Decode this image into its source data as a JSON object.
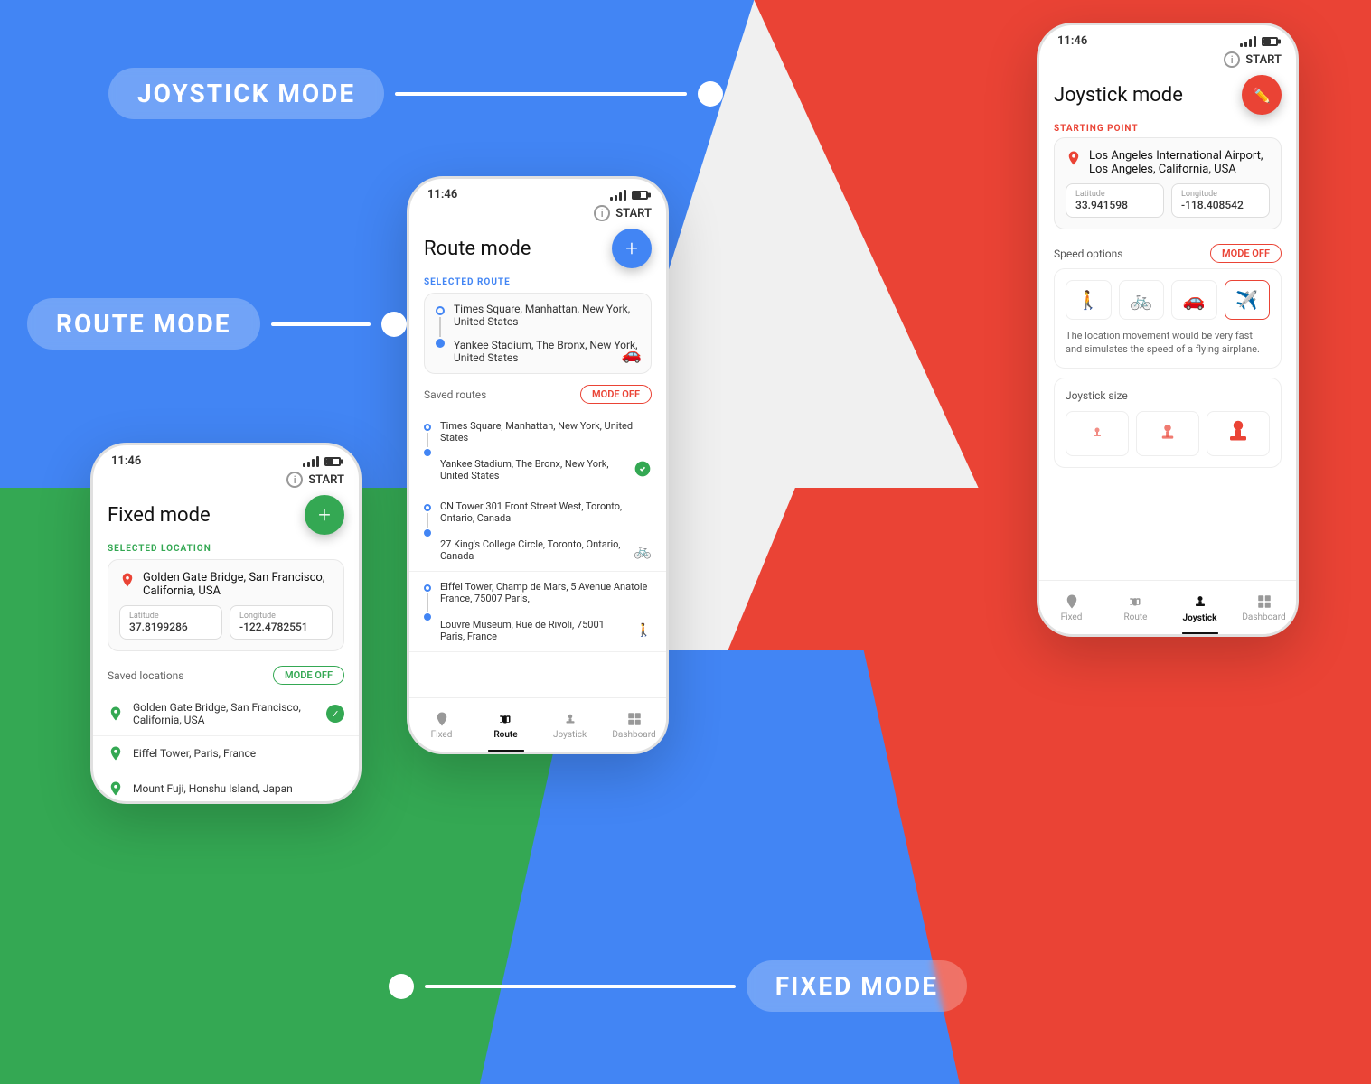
{
  "background": {
    "blue": "#4285F4",
    "green": "#34A853",
    "red": "#EA4335"
  },
  "labels": {
    "joystick": "JOYSTICK MODE",
    "route": "ROUTE MODE",
    "fixed": "FIXED MODE"
  },
  "phone_fixed": {
    "time": "11:46",
    "start": "START",
    "title": "Fixed mode",
    "selected_location_label": "SELECTED LOCATION",
    "location": "Golden Gate Bridge, San Francisco, California, USA",
    "latitude_label": "Latitude",
    "latitude_value": "37.8199286",
    "longitude_label": "Longitude",
    "longitude_value": "-122.4782551",
    "saved_locations": "Saved locations",
    "mode_off": "MODE OFF",
    "saved": [
      {
        "name": "Golden Gate Bridge, San Francisco, California, USA",
        "active": true
      },
      {
        "name": "Eiffel Tower, Paris, France",
        "active": false
      },
      {
        "name": "Mount Fuji, Honshu Island, Japan",
        "active": false
      }
    ],
    "nav": [
      "Fixed",
      "Route",
      "Joystick",
      "Dashboard"
    ]
  },
  "phone_route": {
    "time": "11:46",
    "start": "START",
    "title": "Route mode",
    "selected_route_label": "SELECTED ROUTE",
    "route_from": "Times Square, Manhattan, New York, United States",
    "route_to": "Yankee Stadium, The Bronx, New York, United States",
    "saved_routes": "Saved routes",
    "mode_off": "MODE OFF",
    "routes": [
      {
        "from": "Times Square, Manhattan, New York, United States",
        "to": "Yankee Stadium, The Bronx, New York, United States",
        "icon": "car",
        "active": true
      },
      {
        "from": "CN Tower 301 Front Street West, Toronto, Ontario, Canada",
        "to": "27 King's College Circle, Toronto, Ontario, Canada",
        "icon": "bike",
        "active": false
      },
      {
        "from": "Eiffel Tower, Champ de Mars, 5 Avenue Anatole France, 75007 Paris,",
        "to": "Louvre Museum, Rue de Rivoli, 75001 Paris, France",
        "icon": "person",
        "active": false
      }
    ],
    "nav": [
      "Fixed",
      "Route",
      "Joystick",
      "Dashboard"
    ],
    "active_nav": 1
  },
  "phone_joystick": {
    "time": "11:46",
    "start": "START",
    "title": "Joystick mode",
    "starting_point_label": "STARTING POINT",
    "location": "Los Angeles International Airport, Los Angeles, California, USA",
    "latitude_label": "Latitude",
    "latitude_value": "33.941598",
    "longitude_label": "Longitude",
    "longitude_value": "-118.408542",
    "speed_options_label": "Speed options",
    "mode_off": "MODE OFF",
    "speed_desc": "The location movement would be very fast and simulates the speed of a flying airplane.",
    "speed_icons": [
      "walk",
      "bike",
      "car",
      "plane"
    ],
    "active_speed": 3,
    "joystick_size_label": "Joystick size",
    "joystick_sizes": [
      "small",
      "medium",
      "large"
    ],
    "nav": [
      "Fixed",
      "Route",
      "Joystick",
      "Dashboard"
    ],
    "active_nav": 2
  }
}
